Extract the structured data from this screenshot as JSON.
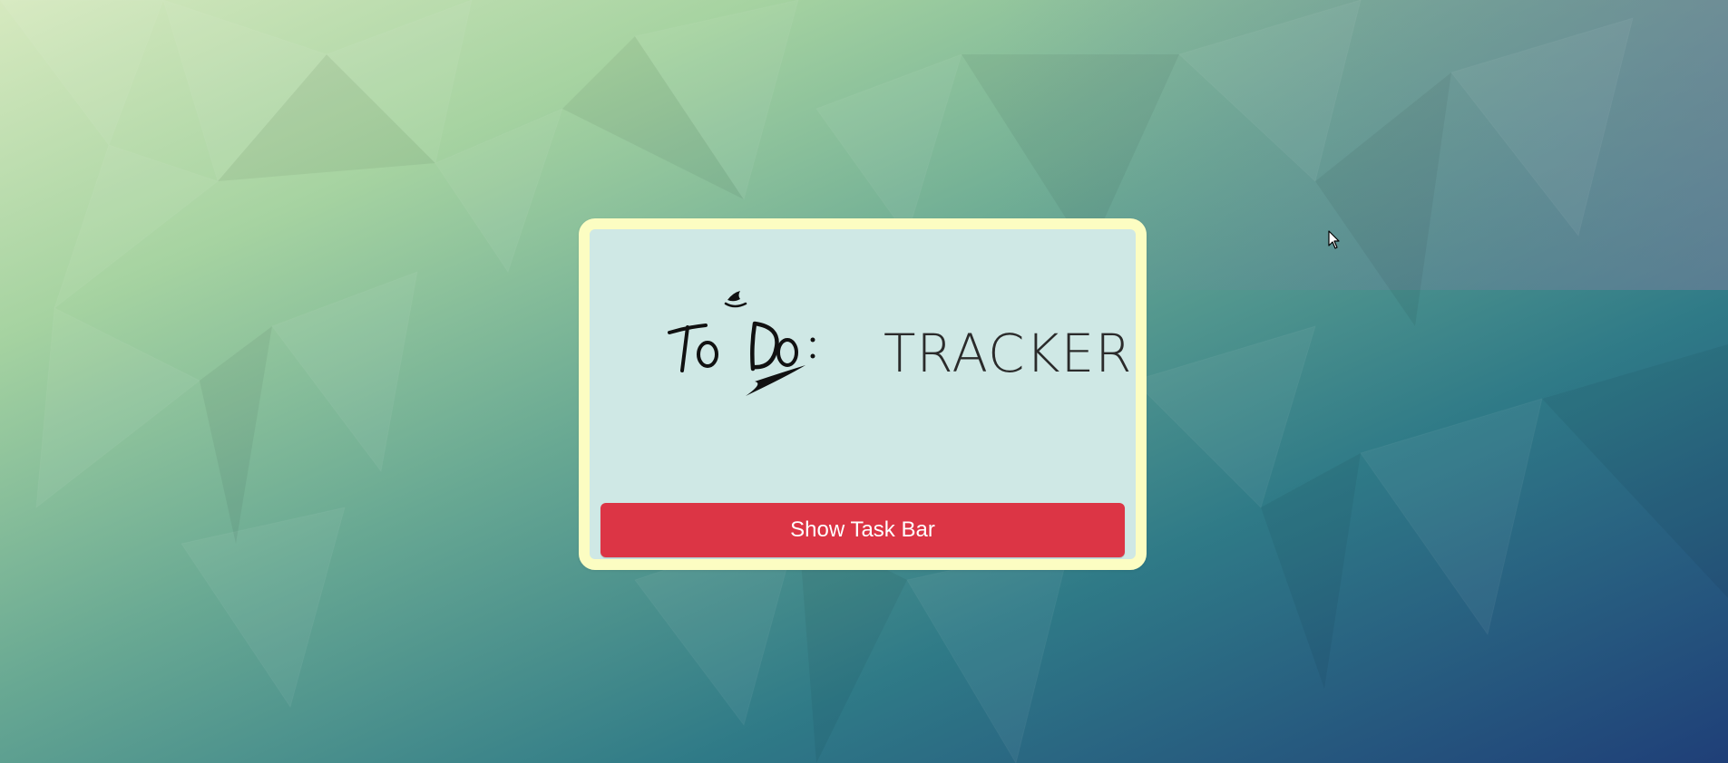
{
  "app": {
    "logo_text": "To Do:",
    "title": "TRACKER"
  },
  "actions": {
    "show_task_bar_label": "Show Task Bar"
  },
  "colors": {
    "card_border": "#fcfdc2",
    "card_background": "#cfe8e5",
    "button_background": "#dc3545",
    "button_text": "#ffffff"
  },
  "icons": {
    "logo": "todo-logo-icon",
    "cursor": "mouse-pointer-icon"
  }
}
